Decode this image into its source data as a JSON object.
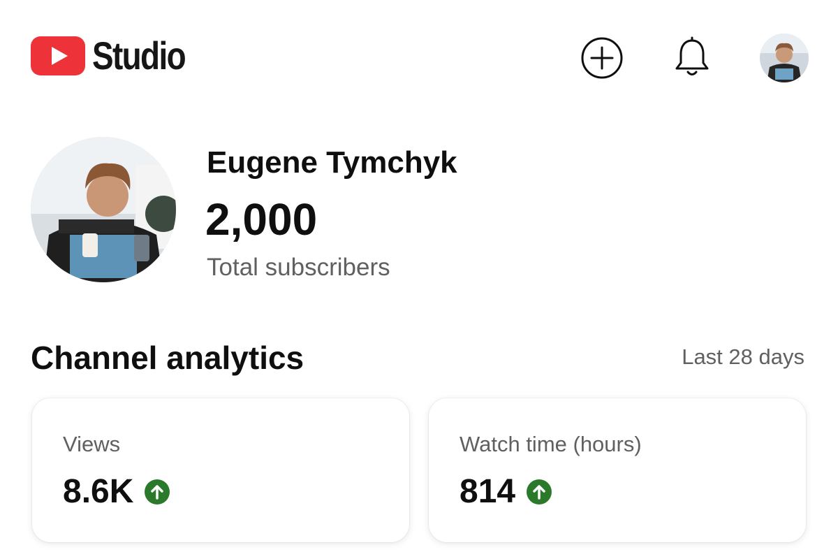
{
  "header": {
    "logo_text": "Studio",
    "icons": {
      "logo": "youtube-play-icon",
      "create": "plus-circle-icon",
      "notifications": "bell-icon",
      "account": "avatar"
    }
  },
  "channel": {
    "name": "Eugene Tymchyk",
    "subscriber_count": "2,000",
    "subscriber_label": "Total subscribers"
  },
  "analytics": {
    "title": "Channel analytics",
    "period": "Last 28 days",
    "cards": [
      {
        "label": "Views",
        "value": "8.6K",
        "trend": "up"
      },
      {
        "label": "Watch time (hours)",
        "value": "814",
        "trend": "up"
      }
    ]
  },
  "colors": {
    "brand_red": "#ff0033",
    "trend_up": "#2b7a2b",
    "secondary_text": "#606060"
  }
}
